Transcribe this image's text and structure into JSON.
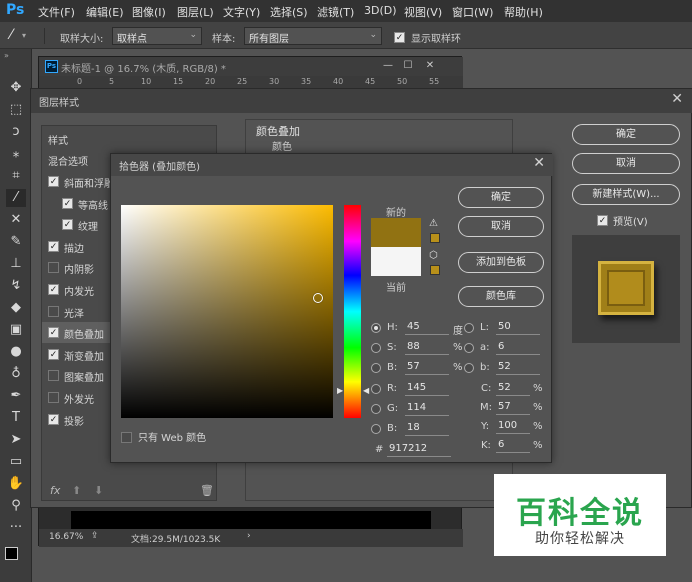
{
  "app": {
    "logo": "Ps",
    "menu": [
      "文件(F)",
      "编辑(E)",
      "图像(I)",
      "图层(L)",
      "文字(Y)",
      "选择(S)",
      "滤镜(T)",
      "3D(D)",
      "视图(V)",
      "窗口(W)",
      "帮助(H)"
    ]
  },
  "options_bar": {
    "sample_size_label": "取样大小:",
    "sample_size_value": "取样点",
    "sample_label": "样本:",
    "sample_value": "所有图层",
    "show_ring_label": "显示取样环"
  },
  "document": {
    "title": "未标题-1 @ 16.7% (木质, RGB/8) *",
    "ruler_ticks": [
      "0",
      "5",
      "10",
      "15",
      "20",
      "25",
      "30",
      "35",
      "40",
      "45",
      "50",
      "55"
    ],
    "zoom": "16.67%",
    "doc_info": "文档:29.5M/1023.5K"
  },
  "layer_style": {
    "title": "图层样式",
    "styles_header": "样式",
    "blend_options": "混合选项",
    "items": [
      {
        "label": "斜面和浮雕",
        "checked": true,
        "indent": false
      },
      {
        "label": "等高线",
        "checked": true,
        "indent": true
      },
      {
        "label": "纹理",
        "checked": true,
        "indent": true
      },
      {
        "label": "描边",
        "checked": true,
        "indent": false
      },
      {
        "label": "内阴影",
        "checked": false,
        "indent": false
      },
      {
        "label": "内发光",
        "checked": true,
        "indent": false
      },
      {
        "label": "光泽",
        "checked": false,
        "indent": false
      },
      {
        "label": "颜色叠加",
        "checked": true,
        "indent": false,
        "selected": true
      },
      {
        "label": "渐变叠加",
        "checked": true,
        "indent": false
      },
      {
        "label": "图案叠加",
        "checked": false,
        "indent": false
      },
      {
        "label": "外发光",
        "checked": false,
        "indent": false
      },
      {
        "label": "投影",
        "checked": true,
        "indent": false
      }
    ],
    "footer_fx": "fx",
    "panel_title": "颜色叠加",
    "panel_subtitle": "颜色",
    "ok": "确定",
    "cancel": "取消",
    "new_style": "新建样式(W)...",
    "preview": "预览(V)"
  },
  "color_picker": {
    "title": "拾色器 (叠加颜色)",
    "ok": "确定",
    "cancel": "取消",
    "add_to_swatches": "添加到色板",
    "color_libraries": "颜色库",
    "new_label": "新的",
    "current_label": "当前",
    "web_only": "只有 Web 颜色",
    "new_color": "#917212",
    "current_color": "#f5f5f5",
    "fields": {
      "H": {
        "value": "45",
        "unit": "度",
        "selected": true
      },
      "S": {
        "value": "88",
        "unit": "%"
      },
      "B": {
        "value": "57",
        "unit": "%"
      },
      "R": {
        "value": "145"
      },
      "G": {
        "value": "114"
      },
      "Bl": {
        "value": "18"
      },
      "L": {
        "value": "50"
      },
      "a": {
        "value": "6"
      },
      "b": {
        "value": "52"
      },
      "C": {
        "value": "52",
        "unit": "%"
      },
      "M": {
        "value": "57",
        "unit": "%"
      },
      "Y": {
        "value": "100",
        "unit": "%"
      },
      "K": {
        "value": "6",
        "unit": "%"
      }
    },
    "hex_label": "#",
    "hex_value": "917212"
  },
  "watermark": {
    "line1": "百科全说",
    "line2": "助你轻松解决"
  }
}
